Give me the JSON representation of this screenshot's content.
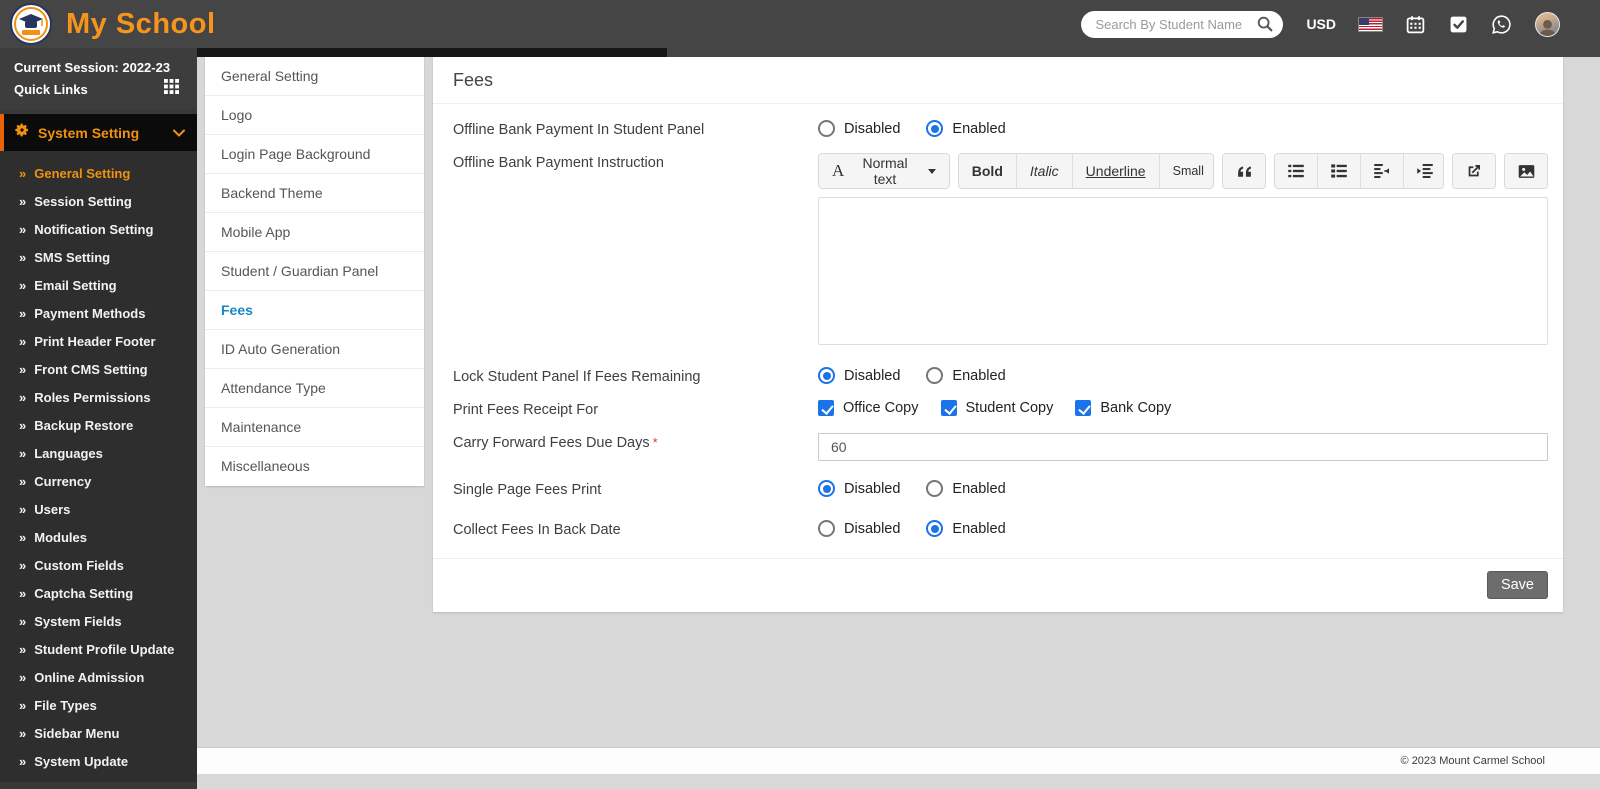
{
  "header": {
    "brand": "My School",
    "search_placeholder": "Search By Student Name",
    "currency_label": "USD"
  },
  "icons": {
    "logo-icon": "graduation-cap-badge",
    "search-icon": "magnifier",
    "us-flag-icon": "usa-flag-stripes-canton",
    "calendar-icon": "calendar-grid",
    "task-check-icon": "check-square",
    "whatsapp-icon": "chat-bubble-phone",
    "grid-icon": "3x3-grid",
    "gears-icon": "cog",
    "chevron-down-icon": "caret-down",
    "double-chevron-icon": "»",
    "blockquote-icon": "double-quote",
    "list-ul-icon": "bulleted-list",
    "list-ol-icon": "numbered-list",
    "outdent-icon": "decrease-indent",
    "indent-icon": "increase-indent",
    "link-icon": "box-arrow-out",
    "picture-icon": "image-mountain"
  },
  "colors": {
    "header_bg": "#454545",
    "sidebar_bg": "#393939",
    "accent_orange": "#f0920e",
    "orange_border": "#e8630a",
    "active_blue": "#1a87c9",
    "control_blue": "#1a73e8",
    "save_button_bg": "#6d6d6d",
    "page_bg": "#d8d8d8"
  },
  "sidebar": {
    "session_label": "Current Session: 2022-23",
    "quick_links_label": "Quick Links",
    "menu_header": "System Setting",
    "items": [
      {
        "label": "General Setting",
        "active": true
      },
      {
        "label": "Session Setting",
        "active": false
      },
      {
        "label": "Notification Setting",
        "active": false
      },
      {
        "label": "SMS Setting",
        "active": false
      },
      {
        "label": "Email Setting",
        "active": false
      },
      {
        "label": "Payment Methods",
        "active": false
      },
      {
        "label": "Print Header Footer",
        "active": false
      },
      {
        "label": "Front CMS Setting",
        "active": false
      },
      {
        "label": "Roles Permissions",
        "active": false
      },
      {
        "label": "Backup Restore",
        "active": false
      },
      {
        "label": "Languages",
        "active": false
      },
      {
        "label": "Currency",
        "active": false
      },
      {
        "label": "Users",
        "active": false
      },
      {
        "label": "Modules",
        "active": false
      },
      {
        "label": "Custom Fields",
        "active": false
      },
      {
        "label": "Captcha Setting",
        "active": false
      },
      {
        "label": "System Fields",
        "active": false
      },
      {
        "label": "Student Profile Update",
        "active": false
      },
      {
        "label": "Online Admission",
        "active": false
      },
      {
        "label": "File Types",
        "active": false
      },
      {
        "label": "Sidebar Menu",
        "active": false
      },
      {
        "label": "System Update",
        "active": false
      }
    ]
  },
  "submenu": {
    "items": [
      {
        "label": "General Setting",
        "active": false
      },
      {
        "label": "Logo",
        "active": false
      },
      {
        "label": "Login Page Background",
        "active": false
      },
      {
        "label": "Backend Theme",
        "active": false
      },
      {
        "label": "Mobile App",
        "active": false
      },
      {
        "label": "Student / Guardian Panel",
        "active": false
      },
      {
        "label": "Fees",
        "active": true
      },
      {
        "label": "ID Auto Generation",
        "active": false
      },
      {
        "label": "Attendance Type",
        "active": false
      },
      {
        "label": "Maintenance",
        "active": false
      },
      {
        "label": "Miscellaneous",
        "active": false
      }
    ]
  },
  "main": {
    "title": "Fees",
    "radio_options": [
      "Disabled",
      "Enabled"
    ],
    "rows": {
      "offline_bank_payment": {
        "label": "Offline Bank Payment In Student Panel",
        "disabled_checked": false,
        "enabled_checked": true
      },
      "offline_instruction": {
        "label": "Offline Bank Payment Instruction",
        "content": ""
      },
      "lock_student_panel": {
        "label": "Lock Student Panel If Fees Remaining",
        "disabled_checked": true,
        "enabled_checked": false
      },
      "print_fees_receipt": {
        "label": "Print Fees Receipt For",
        "options": [
          {
            "label": "Office Copy",
            "checked": true
          },
          {
            "label": "Student Copy",
            "checked": true
          },
          {
            "label": "Bank Copy",
            "checked": true
          }
        ]
      },
      "carry_forward": {
        "label": "Carry Forward Fees Due Days",
        "required_mark": "*",
        "value": "60"
      },
      "single_page": {
        "label": "Single Page Fees Print",
        "disabled_checked": true,
        "enabled_checked": false
      },
      "collect_back_date": {
        "label": "Collect Fees In Back Date",
        "disabled_checked": false,
        "enabled_checked": true
      }
    },
    "editor": {
      "style_letter": "A",
      "style_label": "Normal text",
      "buttons": {
        "bold": "Bold",
        "italic": "Italic",
        "underline": "Underline",
        "small": "Small"
      }
    },
    "save_label": "Save"
  },
  "footer": {
    "copyright": "© 2023 Mount Carmel School"
  }
}
